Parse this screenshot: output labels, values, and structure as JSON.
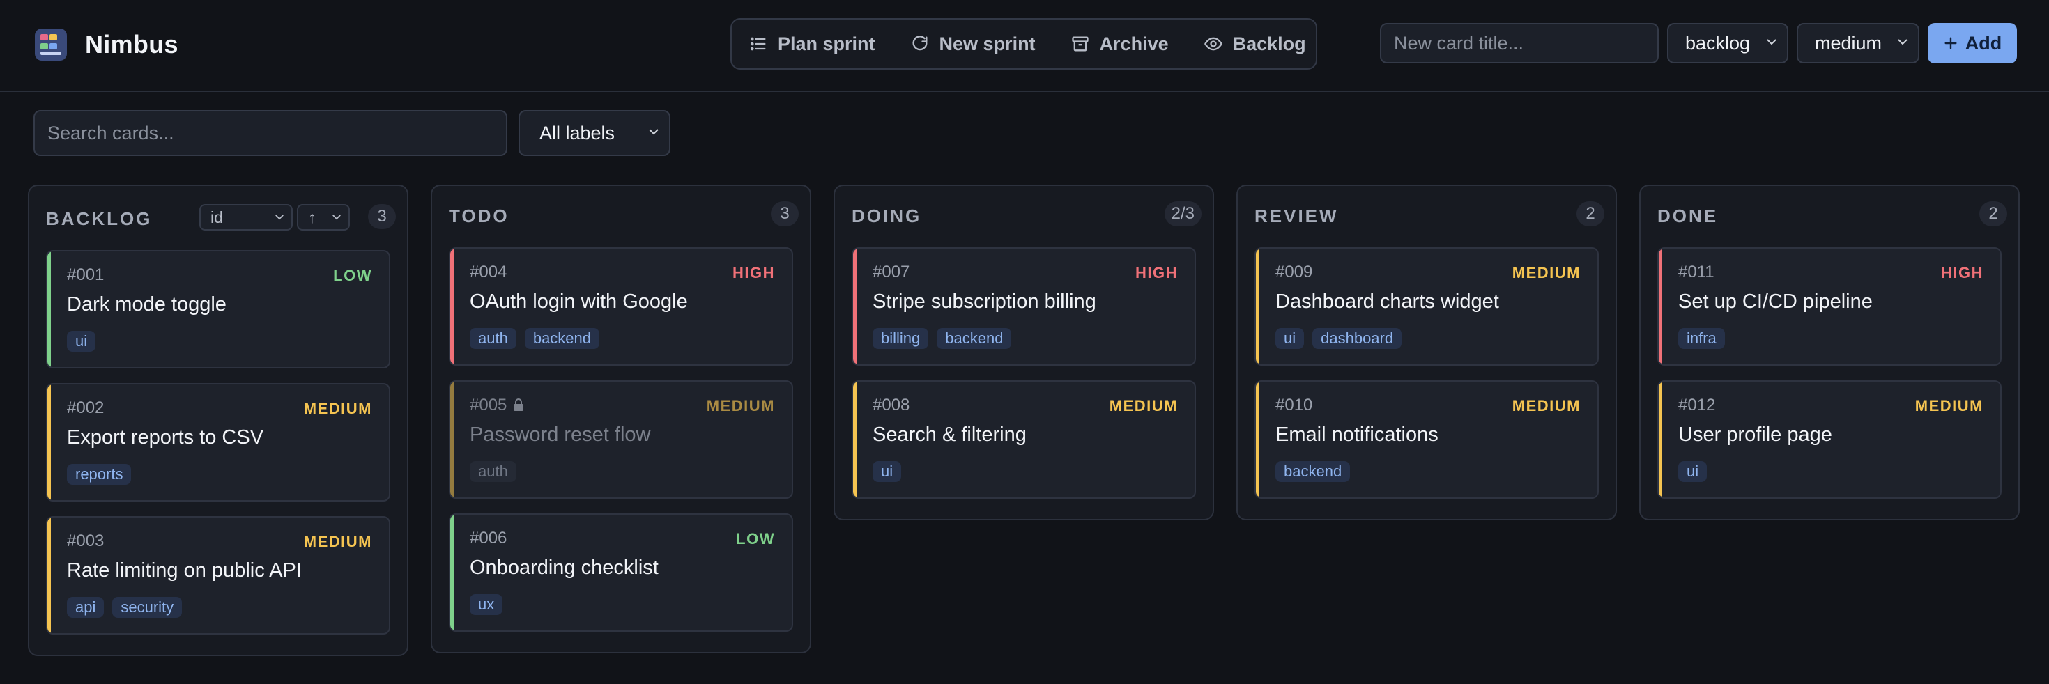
{
  "app": {
    "name": "Nimbus"
  },
  "toolbar": {
    "plan_sprint": "Plan sprint",
    "new_sprint": "New sprint",
    "archive": "Archive",
    "backlog": "Backlog"
  },
  "new_card": {
    "placeholder": "New card title...",
    "value": "",
    "column_select": "backlog",
    "priority_select": "medium",
    "add_label": "Add"
  },
  "filters": {
    "search_placeholder": "Search cards...",
    "search_value": "",
    "label_select": "All labels"
  },
  "colors": {
    "accent": "#7aa7f0",
    "high": "#f07178",
    "medium": "#f5c451",
    "low": "#7fd18b"
  },
  "columns": [
    {
      "title": "BACKLOG",
      "count": "3",
      "sort_field": "id",
      "sort_dir": "↑",
      "cards": [
        {
          "id": "#001",
          "priority": "LOW",
          "title": "Dark mode toggle",
          "tags": [
            "ui"
          ]
        },
        {
          "id": "#002",
          "priority": "MEDIUM",
          "title": "Export reports to CSV",
          "tags": [
            "reports"
          ]
        },
        {
          "id": "#003",
          "priority": "MEDIUM",
          "title": "Rate limiting on public API",
          "tags": [
            "api",
            "security"
          ]
        }
      ]
    },
    {
      "title": "TODO",
      "count": "3",
      "cards": [
        {
          "id": "#004",
          "priority": "HIGH",
          "title": "OAuth login with Google",
          "tags": [
            "auth",
            "backend"
          ]
        },
        {
          "id": "#005",
          "priority": "MEDIUM",
          "title": "Password reset flow",
          "tags": [
            "auth"
          ],
          "locked": true
        },
        {
          "id": "#006",
          "priority": "LOW",
          "title": "Onboarding checklist",
          "tags": [
            "ux"
          ]
        }
      ]
    },
    {
      "title": "DOING",
      "count": "2/3",
      "cards": [
        {
          "id": "#007",
          "priority": "HIGH",
          "title": "Stripe subscription billing",
          "tags": [
            "billing",
            "backend"
          ]
        },
        {
          "id": "#008",
          "priority": "MEDIUM",
          "title": "Search & filtering",
          "tags": [
            "ui"
          ]
        }
      ]
    },
    {
      "title": "REVIEW",
      "count": "2",
      "cards": [
        {
          "id": "#009",
          "priority": "MEDIUM",
          "title": "Dashboard charts widget",
          "tags": [
            "ui",
            "dashboard"
          ]
        },
        {
          "id": "#010",
          "priority": "MEDIUM",
          "title": "Email notifications",
          "tags": [
            "backend"
          ]
        }
      ]
    },
    {
      "title": "DONE",
      "count": "2",
      "cards": [
        {
          "id": "#011",
          "priority": "HIGH",
          "title": "Set up CI/CD pipeline",
          "tags": [
            "infra"
          ]
        },
        {
          "id": "#012",
          "priority": "MEDIUM",
          "title": "User profile page",
          "tags": [
            "ui"
          ]
        }
      ]
    }
  ]
}
